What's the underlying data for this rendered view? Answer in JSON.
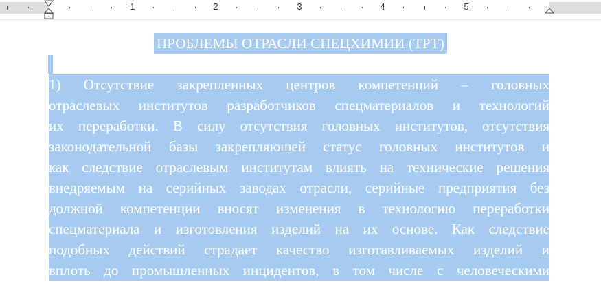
{
  "ruler": {
    "numbers": [
      "1",
      "2",
      "3",
      "4",
      "5"
    ]
  },
  "document": {
    "title": "ПРОБЛЕМЫ ОТРАСЛИ СПЕЦХИМИИ (ТРТ)",
    "paragraph_lines": [
      "1) Отсутствие закрепленных центров компетенций – головных",
      "отраслевых институтов разработчиков спецматериалов и технологий",
      "их переработки. В силу отсутствия головных институтов, отсутствия",
      "законодательной базы закрепляющей статус головных институтов и",
      "как следствие отраслевым институтам влиять на технические решения",
      "внедряемым на серийных заводах отрасли, серийные предприятия без",
      "должной компетенции вносят изменения в технологию переработки",
      "спецматериала и изготовления изделий на их основе. Как следствие",
      "подобных действий страдает качество изготавливаемых изделий и",
      "вплоть до промышленных инцидентов, в том числе с человеческими"
    ]
  },
  "colors": {
    "selection": "#a6caf0",
    "selected_text": "#ffffff"
  }
}
